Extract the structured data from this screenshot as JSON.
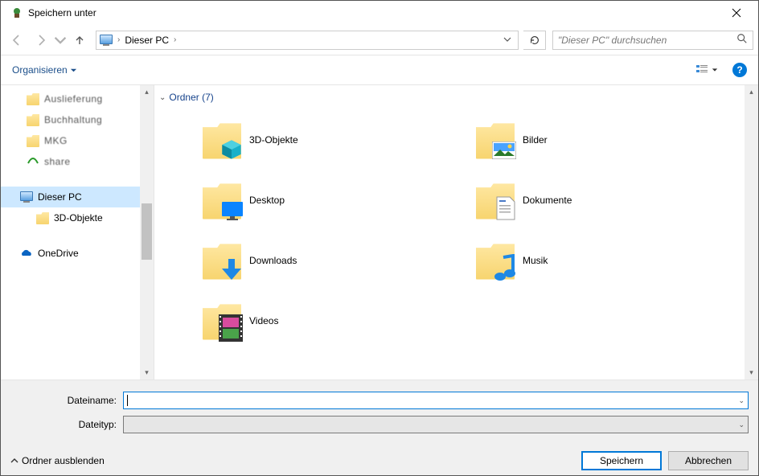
{
  "window": {
    "title": "Speichern unter"
  },
  "nav": {
    "breadcrumb_location": "Dieser PC",
    "search_placeholder": "\"Dieser PC\" durchsuchen"
  },
  "toolbar": {
    "organize_label": "Organisieren"
  },
  "sidebar": {
    "items": [
      {
        "label": "Auslieferung",
        "icon": "folder",
        "obscured": true
      },
      {
        "label": "Buchhaltung",
        "icon": "folder",
        "obscured": true
      },
      {
        "label": "MKG",
        "icon": "folder",
        "obscured": true
      },
      {
        "label": "share",
        "icon": "share",
        "obscured": true
      }
    ],
    "this_pc_label": "Dieser PC",
    "this_pc_child": "3D-Objekte",
    "onedrive_label": "OneDrive"
  },
  "content": {
    "group_label": "Ordner (7)",
    "folders": [
      {
        "name": "3D-Objekte",
        "icon": "3d"
      },
      {
        "name": "Bilder",
        "icon": "pictures"
      },
      {
        "name": "Desktop",
        "icon": "desktop"
      },
      {
        "name": "Dokumente",
        "icon": "documents"
      },
      {
        "name": "Downloads",
        "icon": "downloads"
      },
      {
        "name": "Musik",
        "icon": "music"
      },
      {
        "name": "Videos",
        "icon": "videos"
      }
    ]
  },
  "form": {
    "filename_label": "Dateiname:",
    "filetype_label": "Dateityp:",
    "filename_value": "",
    "filetype_value": ""
  },
  "buttons": {
    "hide_folders": "Ordner ausblenden",
    "save": "Speichern",
    "cancel": "Abbrechen"
  }
}
